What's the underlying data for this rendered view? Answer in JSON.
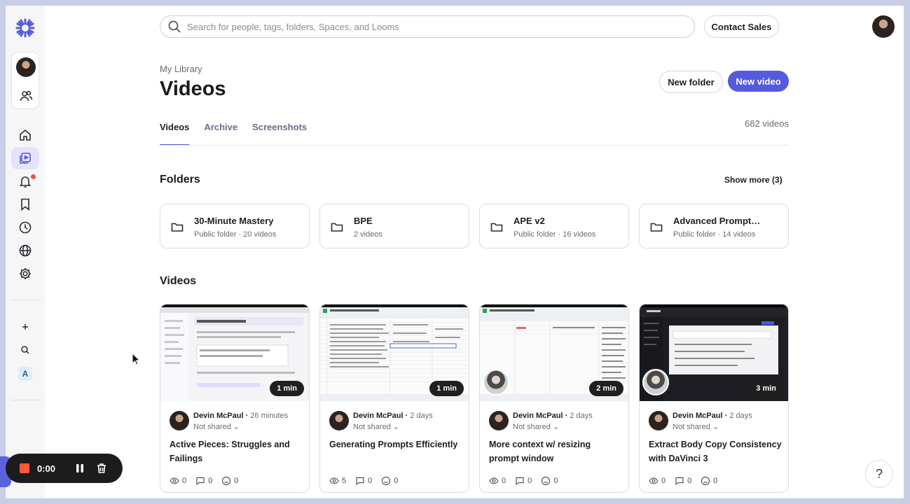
{
  "search": {
    "placeholder": "Search for people, tags, folders, Spaces, and Looms"
  },
  "topbar": {
    "contact_label": "Contact Sales"
  },
  "header": {
    "breadcrumb": "My Library",
    "title": "Videos",
    "new_folder_label": "New folder",
    "new_video_label": "New video"
  },
  "tabs": [
    {
      "label": "Videos",
      "active": true
    },
    {
      "label": "Archive",
      "active": false
    },
    {
      "label": "Screenshots",
      "active": false
    }
  ],
  "video_count": "682 videos",
  "folders_section": {
    "heading": "Folders",
    "show_more": "Show more (3)"
  },
  "folders": [
    {
      "name": "30-Minute Mastery",
      "meta": "Public folder · 20 videos"
    },
    {
      "name": "BPE",
      "meta": "2 videos"
    },
    {
      "name": "APE v2",
      "meta": "Public folder · 16 videos"
    },
    {
      "name": "Advanced Prompt…",
      "meta": "Public folder · 14 videos"
    }
  ],
  "videos_section": {
    "heading": "Videos"
  },
  "videos": [
    {
      "title": "Active Pieces: Struggles and Failings",
      "author": "Devin McPaul",
      "age": "26 minutes",
      "sharing": "Not shared",
      "duration": "1 min",
      "views": "0",
      "comments": "0",
      "reactions": "0"
    },
    {
      "title": "Generating Prompts Efficiently",
      "author": "Devin McPaul",
      "age": "2 days",
      "sharing": "Not shared",
      "duration": "1 min",
      "views": "5",
      "comments": "0",
      "reactions": "0"
    },
    {
      "title": "More context w/ resizing prompt window",
      "author": "Devin McPaul",
      "age": "2 days",
      "sharing": "Not shared",
      "duration": "2 min",
      "views": "0",
      "comments": "0",
      "reactions": "0"
    },
    {
      "title": "Extract Body Copy Consistency with DaVinci 3",
      "author": "Devin McPaul",
      "age": "2 days",
      "sharing": "Not shared",
      "duration": "3 min",
      "views": "0",
      "comments": "0",
      "reactions": "0"
    }
  ],
  "sidebar": {
    "workspace_initial": "A"
  },
  "recorder": {
    "time": "0:00"
  },
  "help_label": "?",
  "colors": {
    "accent": "#565add",
    "record": "#ff5a36",
    "notification": "#f0524b"
  }
}
